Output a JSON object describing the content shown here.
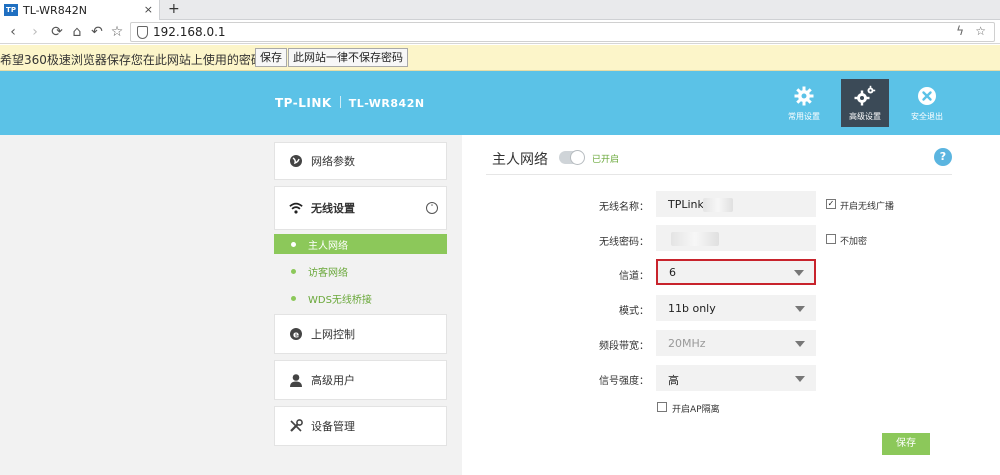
{
  "browser": {
    "tab_icon_text": "TP",
    "tab_title": "TL-WR842N",
    "tab_close": "×",
    "new_tab": "+",
    "url": "192.168.0.1",
    "back": "‹",
    "forward": "›",
    "reload": "⟳",
    "home": "⌂",
    "undo": "↶",
    "star": "☆",
    "bolt": "ϟ",
    "menu": "⋮"
  },
  "infobar": {
    "message": "希望360极速浏览器保存您在此网站上使用的密码吗？",
    "save_label": "保存",
    "never_label": "此网站一律不保存密码"
  },
  "header": {
    "logo": "TP-LINK",
    "model": "TL-WR842N",
    "nav": [
      {
        "label": "常用设置",
        "icon": "gear-icon"
      },
      {
        "label": "高级设置",
        "icon": "gears-icon",
        "active": true
      },
      {
        "label": "安全退出",
        "icon": "exit-icon"
      }
    ]
  },
  "sidebar": {
    "items": [
      {
        "label": "网络参数",
        "icon": "globe-icon"
      },
      {
        "label": "无线设置",
        "icon": "wifi-icon",
        "expanded": true
      },
      {
        "label": "上网控制",
        "icon": "internet-explorer-icon"
      },
      {
        "label": "高级用户",
        "icon": "user-icon"
      },
      {
        "label": "设备管理",
        "icon": "tools-icon"
      }
    ],
    "expand_glyph": "˅",
    "submenu": [
      {
        "label": "主人网络",
        "active": true
      },
      {
        "label": "访客网络"
      },
      {
        "label": "WDS无线桥接"
      }
    ]
  },
  "main": {
    "title": "主人网络",
    "toggle_label": "已开启",
    "toggle_on": true,
    "help": "?",
    "form": {
      "ssid_label": "无线名称：",
      "ssid_value": "TPLink",
      "password_label": "无线密码：",
      "channel_label": "信道：",
      "channel_value": "6",
      "mode_label": "模式：",
      "mode_value": "11b only",
      "bandwidth_label": "频段带宽：",
      "bandwidth_value": "20MHz",
      "signal_label": "信号强度：",
      "signal_value": "高",
      "broadcast_label": "开启无线广播",
      "broadcast_checked": true,
      "broadcast_mark": "✓",
      "noencrypt_label": "不加密",
      "noencrypt_checked": false,
      "ap_isolation_label": "开启AP隔离",
      "ap_isolation_checked": false
    },
    "save_label": "保存"
  },
  "colors": {
    "header_blue": "#5bc2e7",
    "active_nav": "#3b4a57",
    "accent_green": "#8cc85a",
    "highlight_red": "#c8232c"
  }
}
